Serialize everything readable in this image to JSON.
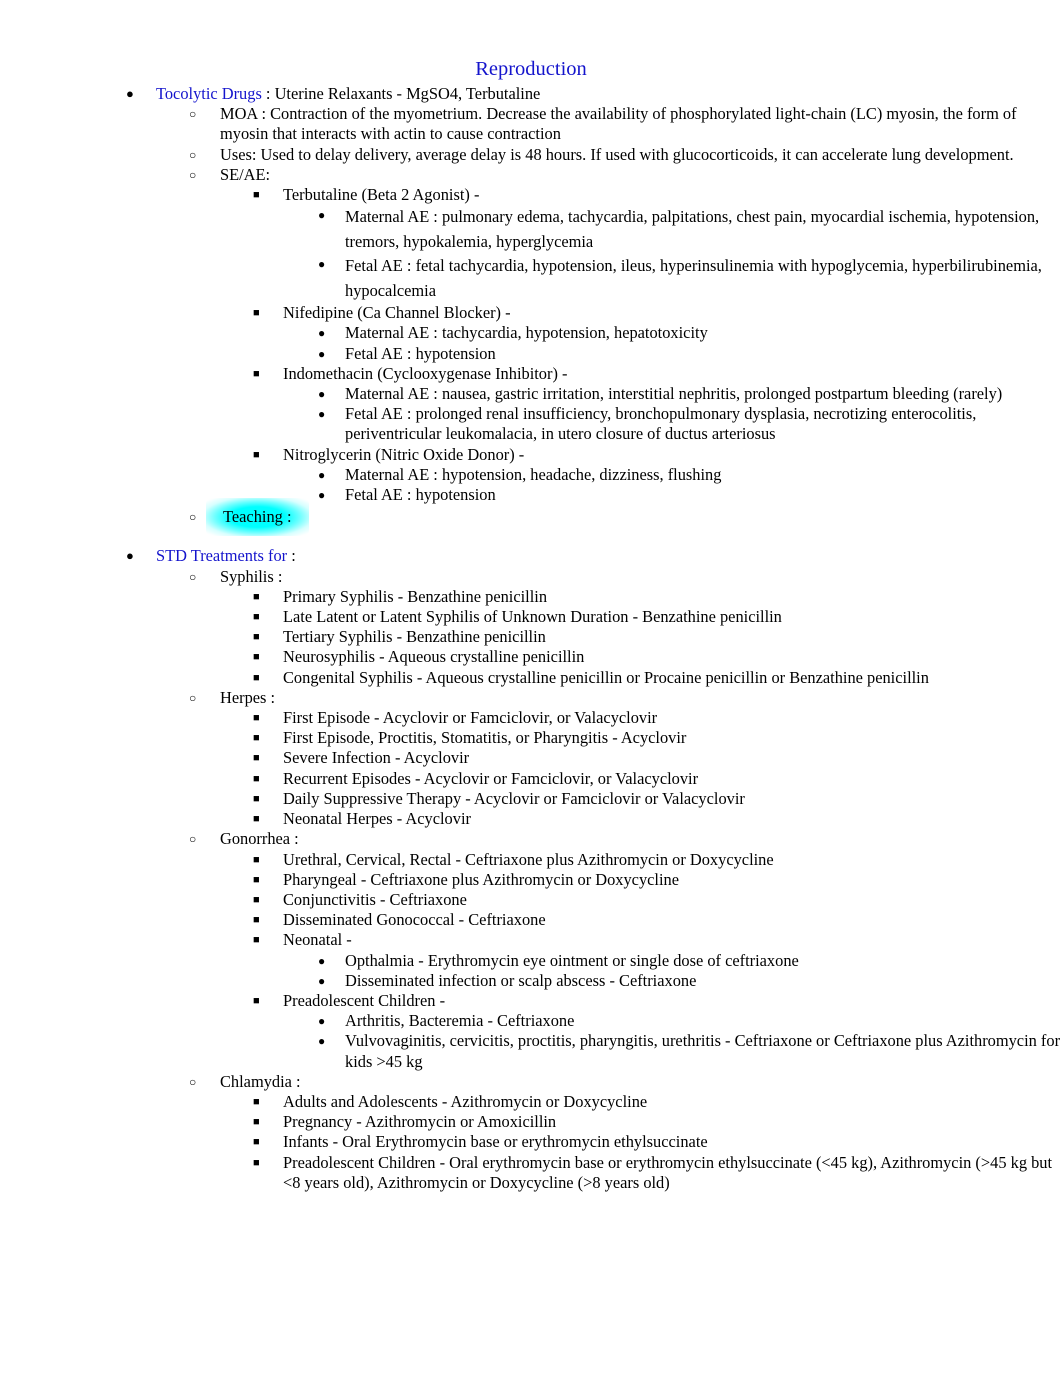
{
  "document": {
    "title": "Reproduction",
    "title_color": "#1414CC",
    "link_color": "#1414CC",
    "highlight_color": "#00FFFF"
  },
  "bullets": {
    "level1": "●",
    "level2": "○",
    "level3": "■",
    "level4": "●"
  },
  "sections": {
    "tocolytic": {
      "heading_link": "Tocolytic Drugs",
      "heading_rest": " : Uterine Relaxants - MgSO4, Terbutaline",
      "moa": "MOA : Contraction of the myometrium. Decrease the availability of phosphorylated light-chain (LC) myosin, the form of myosin that interacts with actin to cause contraction",
      "uses": "Uses: Used to delay delivery, average delay is 48 hours. If used with glucocorticoids, it can accelerate lung development.",
      "se_ae_label": "SE/AE:",
      "drugs": [
        {
          "name": "Terbutaline (Beta 2 Agonist)    -",
          "maternal": "Maternal AE  : pulmonary edema, tachycardia, palpitations, chest pain, myocardial ischemia, hypotension, tremors, hypokalemia, hyperglycemia",
          "fetal": "Fetal AE : fetal tachycardia, hypotension, ileus, hyperinsulinemia with hypoglycemia, hyperbilirubinemia, hypocalcemia"
        },
        {
          "name": "Nifedipine (Ca Channel Blocker)   -",
          "maternal": "Maternal AE : tachycardia, hypotension, hepatotoxicity",
          "fetal": "Fetal AE : hypotension"
        },
        {
          "name": "Indomethacin (Cyclooxygenase Inhibitor)    -",
          "maternal": "Maternal AE  : nausea, gastric irritation, interstitial nephritis, prolonged postpartum bleeding (rarely)",
          "fetal": "Fetal AE : prolonged renal insufficiency, bronchopulmonary dysplasia, necrotizing enterocolitis, periventricular leukomalacia, in utero closure of ductus arteriosus"
        },
        {
          "name": "Nitroglycerin (Nitric Oxide Donor)   -",
          "maternal": "Maternal AE  : hypotension, headache, dizziness, flushing",
          "fetal": "Fetal AE : hypotension"
        }
      ],
      "teaching_label": "Teaching",
      "teaching_colon": " :"
    },
    "std": {
      "heading_link": "STD Treatments for",
      "heading_rest": "  :",
      "syphilis": {
        "label": "Syphilis :",
        "items": [
          "Primary Syphilis   - Benzathine penicillin",
          "Late Latent or Latent Syphilis of Unknown Duration       - Benzathine penicillin",
          "Tertiary Syphilis    - Benzathine penicillin",
          "Neurosyphilis  - Aqueous crystalline penicillin",
          "Congenital Syphilis  - Aqueous crystalline penicillin or Procaine penicillin or Benzathine penicillin"
        ]
      },
      "herpes": {
        "label": "Herpes :",
        "items": [
          "First Episode   - Acyclovir or Famciclovir, or Valacyclovir",
          "First Episode, Proctitis, Stomatitis, or Pharyngitis       - Acyclovir",
          "Severe Infection   - Acyclovir",
          "Recurrent Episodes   - Acyclovir or Famciclovir, or Valacyclovir",
          "Daily Suppressive Therapy    - Acyclovir or Famciclovir or Valacyclovir",
          "Neonatal Herpes   - Acyclovir"
        ]
      },
      "gonorrhea": {
        "label": "Gonorrhea  :",
        "items": [
          "Urethral, Cervical, Rectal    - Ceftriaxone plus Azithromycin or Doxycycline",
          "Pharyngeal   - Ceftriaxone plus Azithromycin or Doxycycline",
          "Conjunctivitis  - Ceftriaxone",
          "Disseminated Gonococcal   - Ceftriaxone"
        ],
        "neonatal": {
          "label": "Neonatal  -",
          "subitems": [
            "Opthalmia   - Erythromycin eye ointment or single dose of ceftriaxone",
            "Disseminated infection or scalp abscess    - Ceftriaxone"
          ]
        },
        "preadolescent": {
          "label": "Preadolescent Children    -",
          "subitems": [
            "Arthritis, Bacteremia     - Ceftriaxone",
            "Vulvovaginitis, cervicitis, proctitis, pharyngitis, urethritis        - Ceftriaxone or Ceftriaxone plus Azithromycin for kids >45 kg"
          ]
        }
      },
      "chlamydia": {
        "label": "Chlamydia  :",
        "items": [
          "Adults and Adolescents    - Azithromycin or Doxycycline",
          "Pregnancy   - Azithromycin or Amoxicillin",
          "Infants  - Oral Erythromycin base or erythromycin ethylsuccinate",
          "Preadolescent Children - Oral erythromycin base or erythromycin ethylsuccinate (<45 kg), Azithromycin (>45 kg but <8 years old), Azithromycin or Doxycycline (>8 years old)"
        ]
      }
    }
  }
}
